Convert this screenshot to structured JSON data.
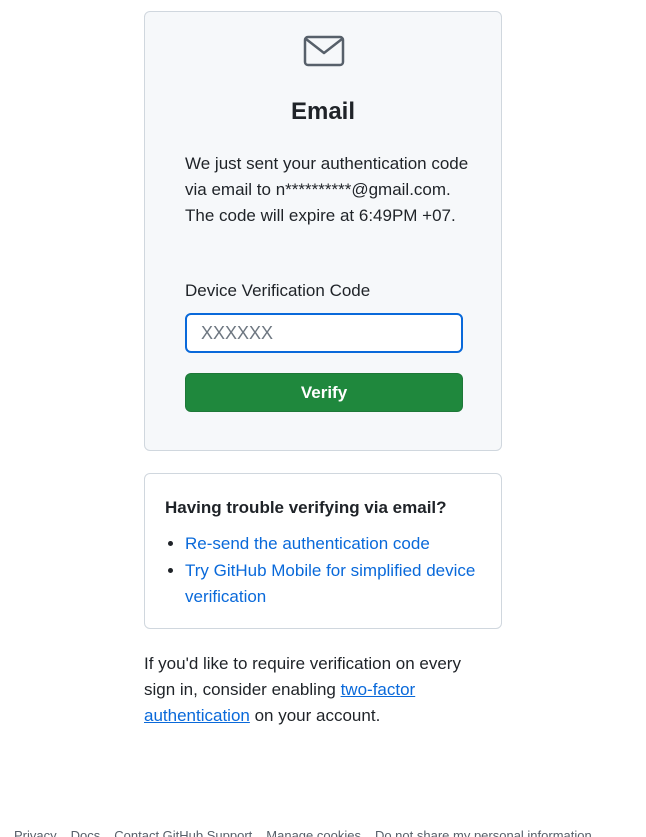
{
  "card": {
    "icon": "mail-icon",
    "title": "Email",
    "message": "We just sent your authentication code via email to n**********@gmail.com. The code will expire at 6:49PM +07.",
    "field_label": "Device Verification Code",
    "input_placeholder": "XXXXXX",
    "input_value": "",
    "verify_label": "Verify"
  },
  "help": {
    "title": "Having trouble verifying via email?",
    "links": [
      "Re-send the authentication code",
      "Try GitHub Mobile for simplified device verification"
    ]
  },
  "note": {
    "before": "If you'd like to require verification on every sign in, consider enabling ",
    "link": "two-factor authentication",
    "after": " on your account."
  },
  "footer": {
    "links": [
      "Privacy",
      "Docs",
      "Contact GitHub Support",
      "Manage cookies",
      "Do not share my personal information"
    ]
  },
  "colors": {
    "accent": "#0969da",
    "primary_button": "#1f883d",
    "card_background": "#f6f8fa",
    "border": "#d0d7de"
  }
}
